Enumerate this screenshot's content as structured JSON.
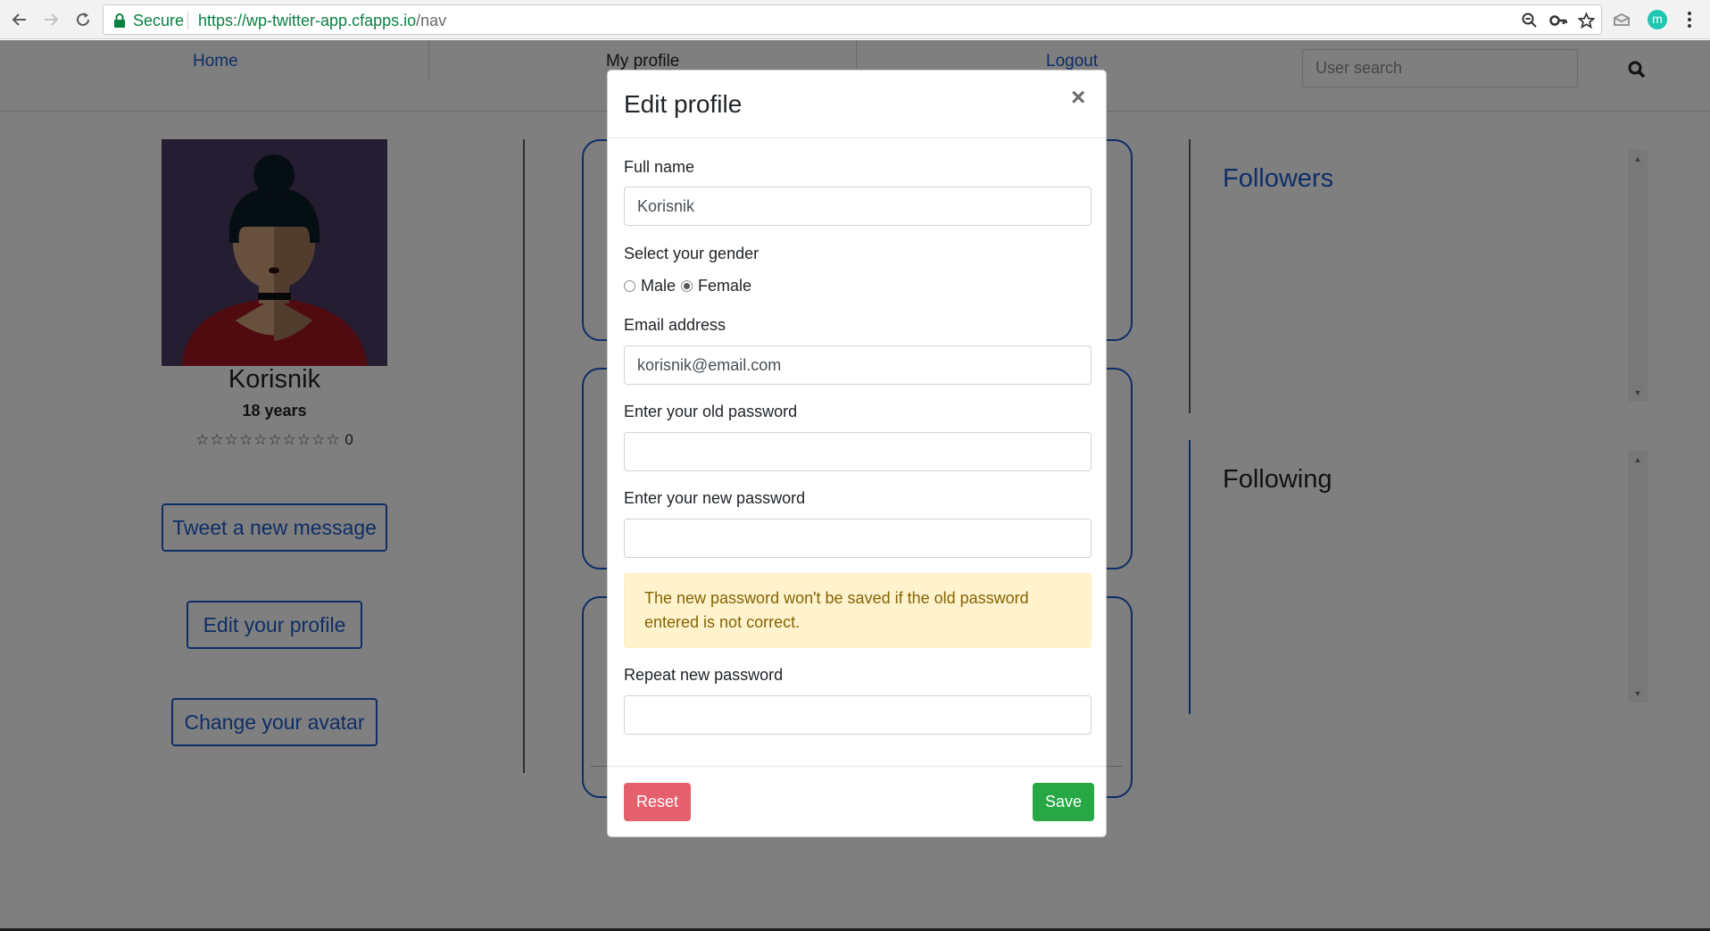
{
  "browser": {
    "secure_label": "Secure",
    "url_host": "https://wp-twitter-app.cfapps.io",
    "url_path": "/nav",
    "profile_initial": "m"
  },
  "navbar": {
    "home": "Home",
    "my_profile": "My profile",
    "logout": "Logout",
    "search_placeholder": "User search"
  },
  "profile": {
    "name": "Korisnik",
    "age": "18 years",
    "stars": "☆☆☆☆☆☆☆☆☆☆",
    "rating": "0",
    "buttons": {
      "tweet": "Tweet a new message",
      "edit": "Edit your profile",
      "avatar": "Change your avatar"
    }
  },
  "panels": {
    "followers_title": "Followers",
    "following_title": "Following"
  },
  "modal": {
    "title": "Edit profile",
    "close_symbol": "×",
    "full_name_label": "Full name",
    "full_name_value": "Korisnik",
    "gender_label": "Select your gender",
    "gender_options": [
      "Male",
      "Female"
    ],
    "gender_selected": "Female",
    "email_label": "Email address",
    "email_value": "korisnik@email.com",
    "old_password_label": "Enter your old password",
    "new_password_label": "Enter your new password",
    "warning_text": "The new password won't be saved if the old password entered is not correct.",
    "repeat_password_label": "Repeat new password",
    "reset_label": "Reset",
    "save_label": "Save"
  },
  "colors": {
    "link_blue": "#1d5ccf",
    "secure_green": "#0b8043",
    "reset_red": "#e4606d",
    "save_green": "#28a745",
    "warning_bg": "#fff3cd",
    "warning_text": "#856404",
    "avatar_bg": "#4b3a63"
  },
  "icons": {
    "back": "arrow-left-icon",
    "forward": "arrow-right-icon",
    "reload": "reload-icon",
    "secure": "lock-icon",
    "zoom": "zoom-icon",
    "password": "key-icon",
    "bookmark": "star-icon",
    "extension": "extension-icon",
    "menu": "kebab-menu-icon",
    "search": "search-icon",
    "close": "close-icon"
  }
}
